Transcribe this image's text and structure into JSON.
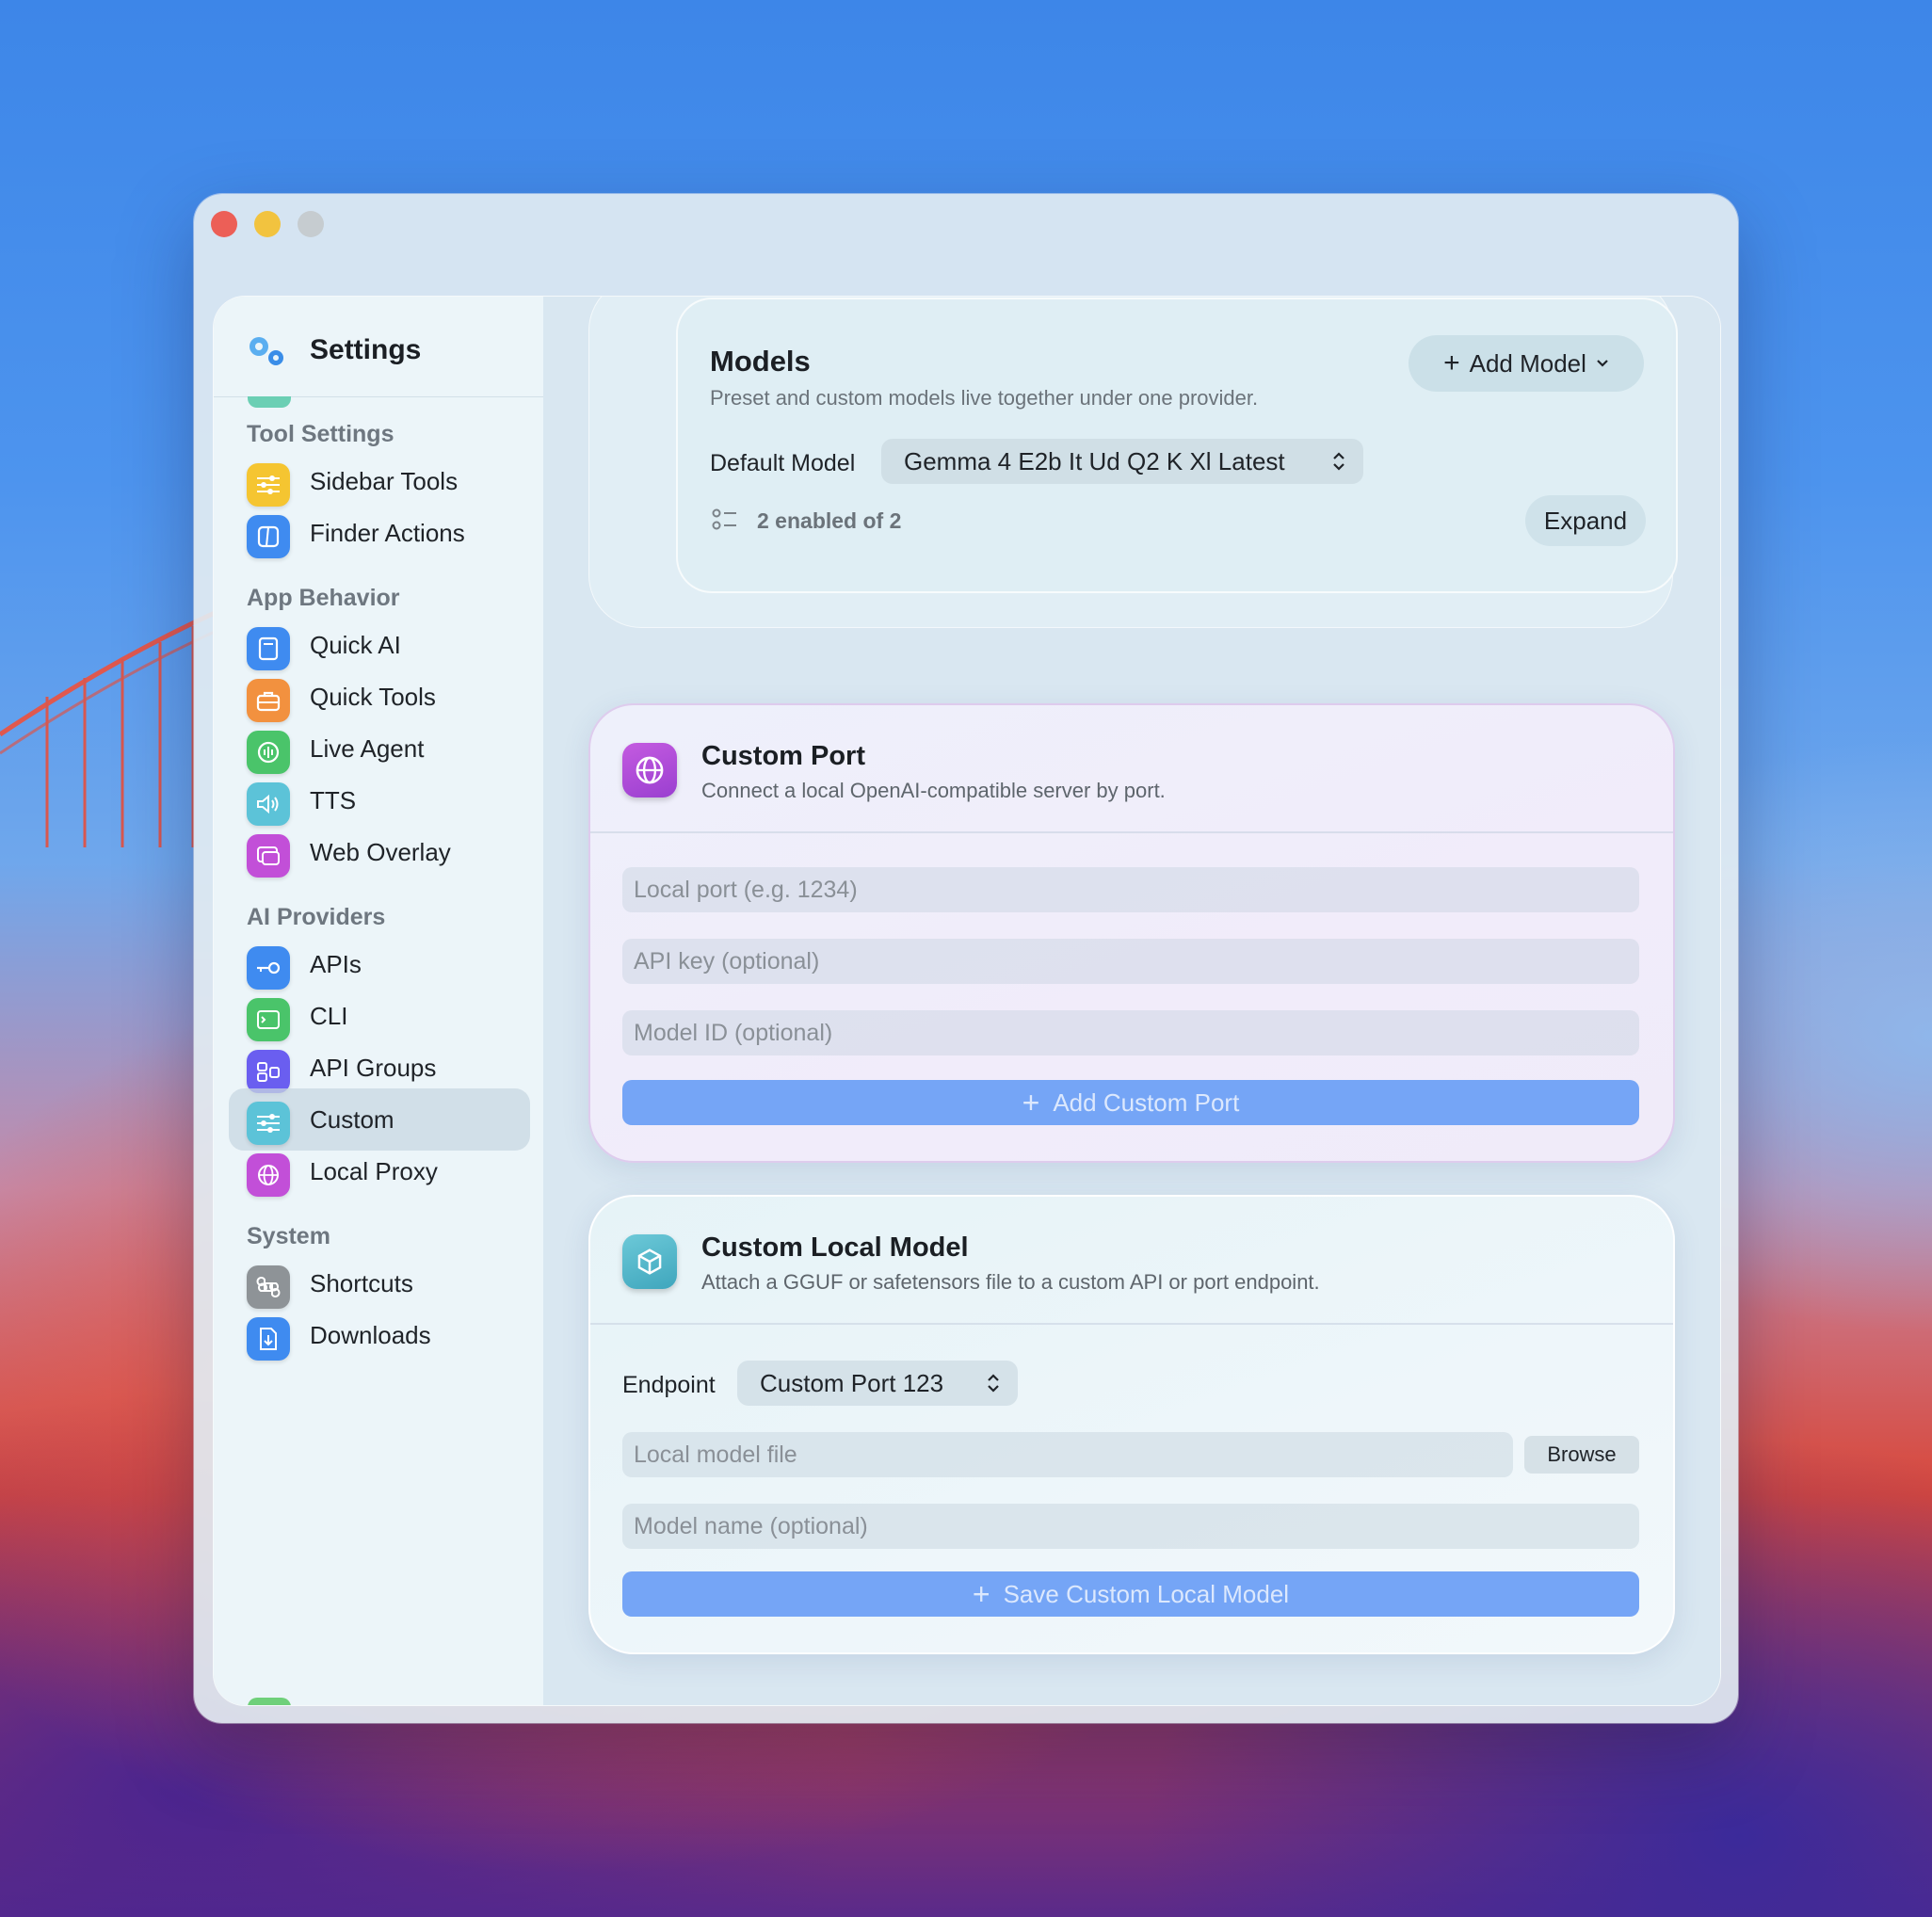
{
  "window_controls": {
    "close_color": "#ec5f57",
    "minimize_color": "#f2c33f",
    "zoom_color": "#c6ccd0"
  },
  "sidebar": {
    "title": "Settings",
    "sections": [
      {
        "label": "Tool Settings",
        "items": [
          {
            "label": "Sidebar Tools",
            "icon": "sliders-icon",
            "color": "#f5c531"
          },
          {
            "label": "Finder Actions",
            "icon": "finder-icon",
            "color": "#3f8bf0"
          }
        ]
      },
      {
        "label": "App Behavior",
        "items": [
          {
            "label": "Quick AI",
            "icon": "window-icon",
            "color": "#3f8bf0"
          },
          {
            "label": "Quick Tools",
            "icon": "toolbox-icon",
            "color": "#f2913f"
          },
          {
            "label": "Live Agent",
            "icon": "waveform-icon",
            "color": "#4ac46a"
          },
          {
            "label": "TTS",
            "icon": "speaker-icon",
            "color": "#5cc3d8"
          },
          {
            "label": "Web Overlay",
            "icon": "overlay-icon",
            "color": "#c24fd8"
          }
        ]
      },
      {
        "label": "AI Providers",
        "items": [
          {
            "label": "APIs",
            "icon": "key-icon",
            "color": "#3f8bf0"
          },
          {
            "label": "CLI",
            "icon": "terminal-icon",
            "color": "#4ac46a"
          },
          {
            "label": "API Groups",
            "icon": "groups-icon",
            "color": "#6a5ef0"
          },
          {
            "label": "Custom",
            "icon": "sliders-icon",
            "color": "#5cc3d8",
            "active": true
          },
          {
            "label": "Local Proxy",
            "icon": "globe-icon",
            "color": "#c24fd8"
          }
        ]
      },
      {
        "label": "System",
        "items": [
          {
            "label": "Shortcuts",
            "icon": "command-icon",
            "color": "#8e9397"
          },
          {
            "label": "Downloads",
            "icon": "download-icon",
            "color": "#3f8bf0"
          }
        ]
      }
    ]
  },
  "models": {
    "title": "Models",
    "subtitle": "Preset and custom models live together under one provider.",
    "add_button": "Add Model",
    "default_label": "Default Model",
    "default_value": "Gemma 4 E2b It Ud Q2 K Xl Latest",
    "enabled_text": "2 enabled of 2",
    "expand_button": "Expand"
  },
  "custom_port": {
    "title": "Custom Port",
    "subtitle": "Connect a local OpenAI-compatible server by port.",
    "port_placeholder": "Local port (e.g. 1234)",
    "api_key_placeholder": "API key (optional)",
    "model_id_placeholder": "Model ID (optional)",
    "add_button": "Add Custom Port"
  },
  "custom_local_model": {
    "title": "Custom Local Model",
    "subtitle": "Attach a GGUF or safetensors file to a custom API or port endpoint.",
    "endpoint_label": "Endpoint",
    "endpoint_value": "Custom Port 123",
    "file_placeholder": "Local model file",
    "browse_button": "Browse",
    "name_placeholder": "Model name (optional)",
    "save_button": "Save Custom Local Model"
  }
}
